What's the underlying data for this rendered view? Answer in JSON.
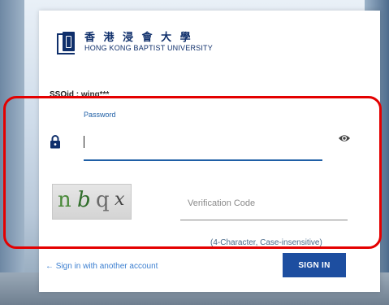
{
  "logo": {
    "zh": "香 港 浸 會 大 學",
    "en": "HONG KONG BAPTIST UNIVERSITY"
  },
  "ssoid": {
    "label": "SSOid :",
    "value": " wing***"
  },
  "password": {
    "label": "Password",
    "value": "",
    "icon": "lock-icon",
    "toggle_icon": "eye-icon"
  },
  "captcha": {
    "chars": [
      "n",
      "b",
      "q",
      "x"
    ],
    "colors": [
      "#4a8a3a",
      "#2f6d2a",
      "#6a6a6a",
      "#444444"
    ]
  },
  "verification": {
    "placeholder": "Verification Code",
    "hint": "(4-Character, Case-insensitive)"
  },
  "actions": {
    "switch_account": "← Sign in with another account",
    "sign_in": "SIGN IN"
  },
  "colors": {
    "accent": "#1d4ea0",
    "highlight": "#e40000",
    "link": "#3c7fd0"
  }
}
